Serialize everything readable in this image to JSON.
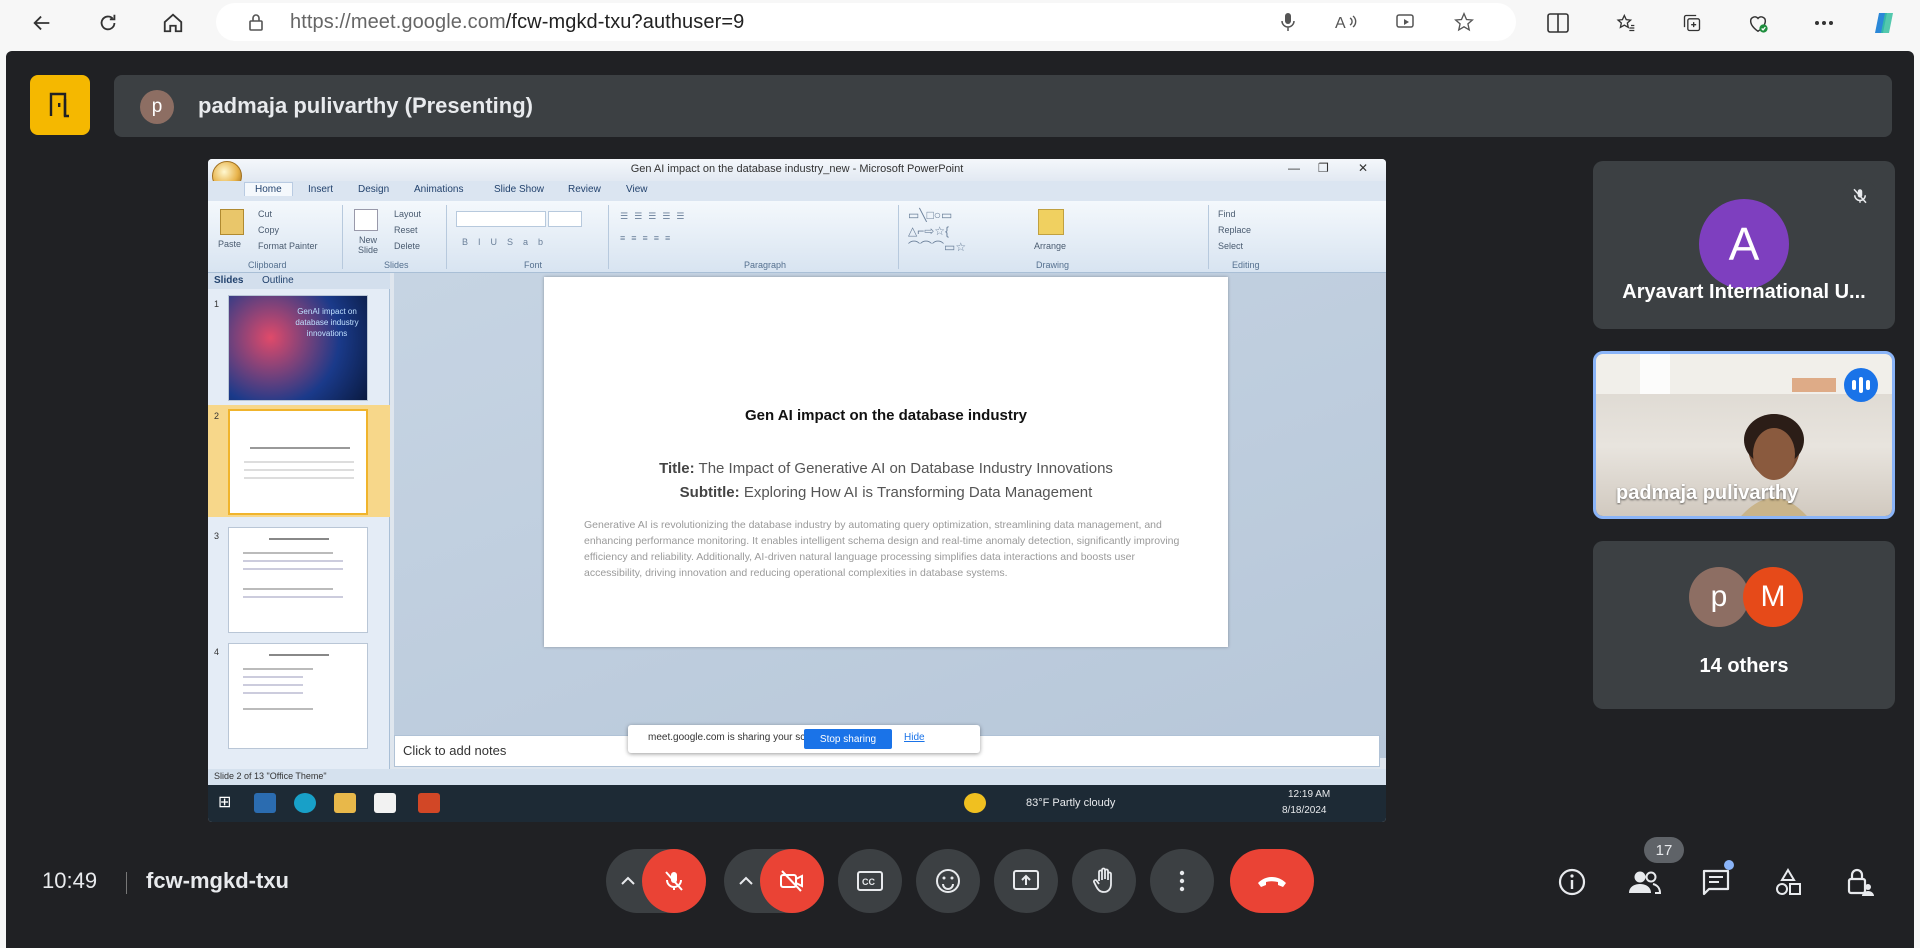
{
  "browser": {
    "url_host": "https://meet.google.com",
    "url_path": "/fcw-mgkd-txu?authuser=9"
  },
  "meet": {
    "presenter": {
      "initial": "p",
      "label": "padmaja pulivarthy (Presenting)"
    },
    "shared_screen": {
      "window_title": "Gen AI impact on the database industry_new - Microsoft PowerPoint",
      "ribbon_tabs": [
        "Home",
        "Insert",
        "Design",
        "Animations",
        "Slide Show",
        "Review",
        "View"
      ],
      "clipboard": {
        "paste": "Paste",
        "cut": "Cut",
        "copy": "Copy",
        "format_painter": "Format Painter",
        "group": "Clipboard"
      },
      "slides_group": {
        "new_slide": "New Slide",
        "layout": "Layout",
        "reset": "Reset",
        "delete": "Delete",
        "group": "Slides"
      },
      "groups": {
        "font": "Font",
        "paragraph": "Paragraph",
        "drawing": "Drawing",
        "editing": "Editing",
        "arrange": "Arrange"
      },
      "editing": {
        "find": "Find",
        "replace": "Replace",
        "select": "Select"
      },
      "pane_tabs": [
        "Slides",
        "Outline"
      ],
      "thumb_numbers": [
        "1",
        "2",
        "3",
        "4"
      ],
      "thumb1_text": "GenAI impact on database industry innovations",
      "slide": {
        "heading": "Gen AI impact on the database industry",
        "title_label": "Title:",
        "title_text": "The Impact of Generative AI on Database Industry Innovations",
        "subtitle_label": "Subtitle:",
        "subtitle_text": "Exploring How AI is Transforming Data Management",
        "body": "Generative AI is revolutionizing the database industry by automating query optimization, streamlining data management, and enhancing performance monitoring. It enables intelligent schema design and real-time anomaly detection, significantly improving efficiency and reliability. Additionally, AI-driven natural language processing simplifies data interactions and boosts user accessibility, driving innovation and reducing operational complexities in database systems."
      },
      "notes_placeholder": "Click to add notes",
      "share_banner": {
        "text": "meet.google.com is sharing your screen.",
        "stop": "Stop sharing",
        "hide": "Hide"
      },
      "status": "Slide 2 of 13    \"Office Theme\"",
      "taskbar": {
        "weather": "83°F  Partly cloudy",
        "time": "12:19 AM",
        "date": "8/18/2024"
      }
    },
    "tiles": [
      {
        "initial": "A",
        "name": "Aryavart International U...",
        "color": "#7e3fbf"
      },
      {
        "name": "padmaja pulivarthy"
      },
      {
        "initials": [
          "p",
          "M"
        ],
        "colors": [
          "#8d6e63",
          "#e64a19"
        ],
        "name": "14 others"
      }
    ],
    "bottom": {
      "time": "10:49",
      "meeting_code": "fcw-mgkd-txu",
      "participant_count": "17"
    }
  }
}
